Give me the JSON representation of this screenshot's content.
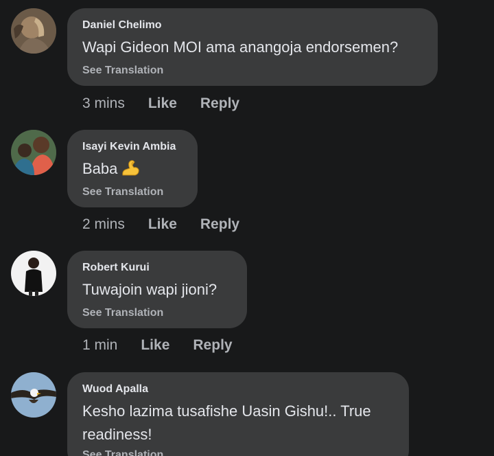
{
  "comments": [
    {
      "author": "Daniel Chelimo",
      "text": "Wapi Gideon MOI ama anangoja endorsemen?",
      "see_translation": "See Translation",
      "time": "3 mins",
      "like": "Like",
      "reply": "Reply"
    },
    {
      "author": "Isayi Kevin Ambia",
      "text": "Baba",
      "emoji": "flexed-biceps-icon",
      "see_translation": "See Translation",
      "time": "2 mins",
      "like": "Like",
      "reply": "Reply"
    },
    {
      "author": "Robert Kurui",
      "text": "Tuwajoin wapi jioni?",
      "see_translation": "See Translation",
      "time": "1 min",
      "like": "Like",
      "reply": "Reply"
    },
    {
      "author": "Wuod Apalla",
      "text": "Kesho lazima tusafishe Uasin Gishu!.. True readiness!",
      "see_translation": "See Translation"
    }
  ],
  "colors": {
    "background": "#18191a",
    "bubble": "#3a3b3c",
    "primary_text": "#e4e6eb",
    "secondary_text": "#b0b3b8"
  }
}
